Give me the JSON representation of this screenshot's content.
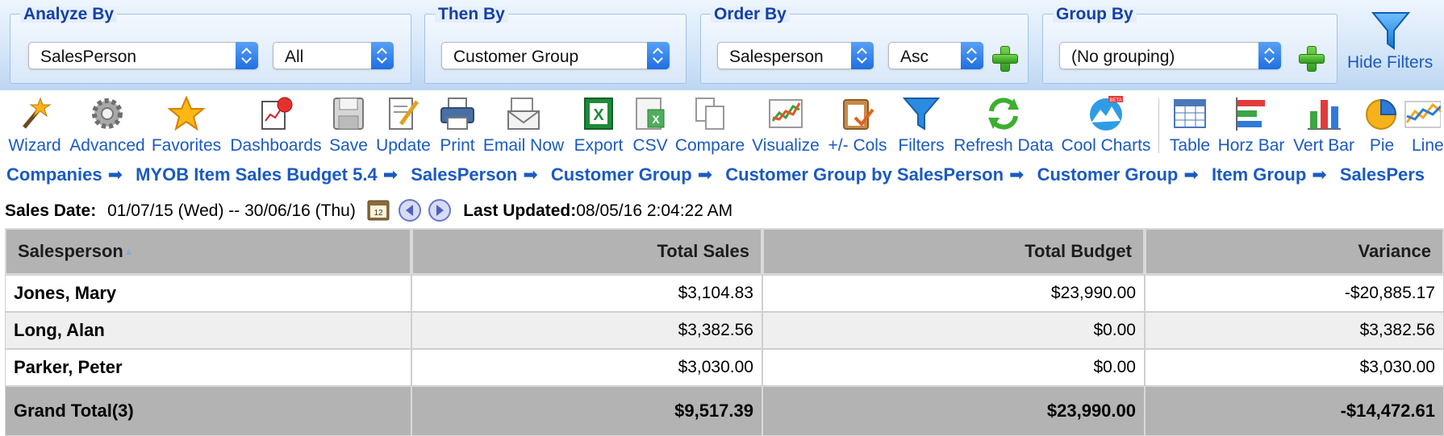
{
  "filters": {
    "analyze_by": {
      "legend": "Analyze By",
      "field": "SalesPerson",
      "scope": "All"
    },
    "then_by": {
      "legend": "Then By",
      "field": "Customer Group"
    },
    "order_by": {
      "legend": "Order By",
      "field": "Salesperson",
      "direction": "Asc"
    },
    "group_by": {
      "legend": "Group By",
      "field": "(No grouping)"
    },
    "hide_filters_label": "Hide Filters"
  },
  "toolbar": {
    "wizard": "Wizard",
    "advanced": "Advanced",
    "favorites": "Favorites",
    "dashboards": "Dashboards",
    "save": "Save",
    "update": "Update",
    "print": "Print",
    "email_now": "Email Now",
    "export": "Export",
    "csv": "CSV",
    "compare": "Compare",
    "visualize": "Visualize",
    "cols": "+/- Cols",
    "filters": "Filters",
    "refresh_data": "Refresh Data",
    "cool_charts": "Cool Charts",
    "cool_charts_badge": "BETA",
    "table": "Table",
    "horz_bar": "Horz Bar",
    "vert_bar": "Vert Bar",
    "pie": "Pie",
    "line": "Line"
  },
  "breadcrumb": [
    "Companies",
    "MYOB Item Sales Budget 5.4",
    "SalesPerson",
    "Customer Group",
    "Customer Group by SalesPerson",
    "Customer Group",
    "Item Group",
    "SalesPers"
  ],
  "date_row": {
    "sales_date_label": "Sales Date:",
    "sales_date_value": "01/07/15 (Wed) -- 30/06/16 (Thu)",
    "last_updated_label": "Last Updated:",
    "last_updated_value": "08/05/16 2:04:22 AM"
  },
  "table": {
    "headers": {
      "salesperson": "Salesperson",
      "total_sales": "Total Sales",
      "total_budget": "Total Budget",
      "variance": "Variance"
    },
    "rows": [
      {
        "salesperson": "Jones, Mary",
        "total_sales": "$3,104.83",
        "total_budget": "$23,990.00",
        "variance": "-$20,885.17"
      },
      {
        "salesperson": "Long, Alan",
        "total_sales": "$3,382.56",
        "total_budget": "$0.00",
        "variance": "$3,382.56"
      },
      {
        "salesperson": "Parker, Peter",
        "total_sales": "$3,030.00",
        "total_budget": "$0.00",
        "variance": "$3,030.00"
      }
    ],
    "total": {
      "label": "Grand Total(3)",
      "total_sales": "$9,517.39",
      "total_budget": "$23,990.00",
      "variance": "-$14,472.61"
    }
  },
  "colors": {
    "link": "#1a5ac2",
    "negative": "#e81111",
    "header_bg": "#b3b3b3",
    "filter_legend": "#1540a4"
  }
}
